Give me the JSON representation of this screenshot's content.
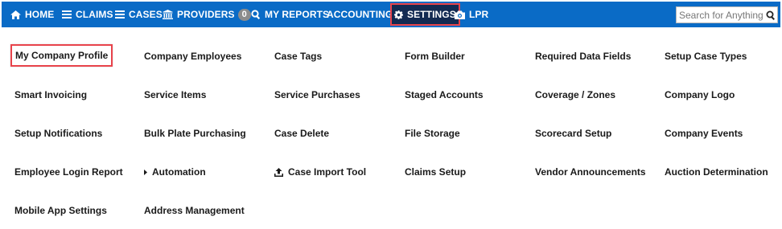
{
  "nav": {
    "home": "HOME",
    "claims": "CLAIMS",
    "cases": "CASES",
    "providers": "PROVIDERS",
    "providers_badge": "0",
    "my_reports": "MY REPORTS",
    "accounting": "ACCOUNTING",
    "settings": "SETTINGS",
    "lpr": "LPR"
  },
  "search": {
    "placeholder": "Search for Anything"
  },
  "colors": {
    "nav_bg": "#0a6bc6",
    "active_bg": "#132a52",
    "highlight": "#e8434b"
  },
  "menu": {
    "col1": [
      "My Company Profile",
      "Smart Invoicing",
      "Setup Notifications",
      "Employee Login Report",
      "Mobile App Settings"
    ],
    "col2": [
      "Company Employees",
      "Service Items",
      "Bulk Plate Purchasing",
      "Automation",
      "Address Management"
    ],
    "col3": [
      "Case Tags",
      "Service Purchases",
      "Case Delete",
      "Case Import Tool"
    ],
    "col4": [
      "Form Builder",
      "Staged Accounts",
      "File Storage",
      "Claims Setup"
    ],
    "col5": [
      "Required Data Fields",
      "Coverage / Zones",
      "Scorecard Setup",
      "Vendor Announcements"
    ],
    "col6": [
      "Setup Case Types",
      "Company Logo",
      "Company Events",
      "Auction Determination"
    ]
  }
}
